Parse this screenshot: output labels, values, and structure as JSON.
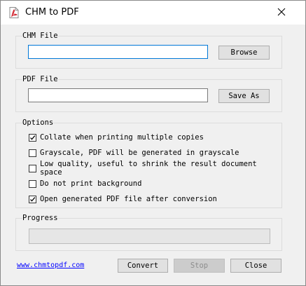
{
  "window": {
    "title": "CHM to PDF"
  },
  "chm_group": {
    "label": "CHM File",
    "value": "",
    "browse_label": "Browse"
  },
  "pdf_group": {
    "label": "PDF File",
    "value": "",
    "saveas_label": "Save As"
  },
  "options": {
    "label": "Options",
    "items": [
      {
        "label": "Collate when printing multiple copies",
        "checked": true
      },
      {
        "label": "Grayscale, PDF will be generated in grayscale",
        "checked": false
      },
      {
        "label": "Low quality, useful to shrink the result document space",
        "checked": false
      },
      {
        "label": "Do not print background",
        "checked": false
      },
      {
        "label": "Open generated PDF file after conversion",
        "checked": true
      }
    ]
  },
  "progress": {
    "label": "Progress",
    "value": 0
  },
  "footer": {
    "link": "www.chmtopdf.com",
    "convert_label": "Convert",
    "stop_label": "Stop",
    "close_label": "Close"
  },
  "colors": {
    "link": "#0000ff",
    "focus_border": "#0078d7",
    "checkmark": "#000000"
  }
}
